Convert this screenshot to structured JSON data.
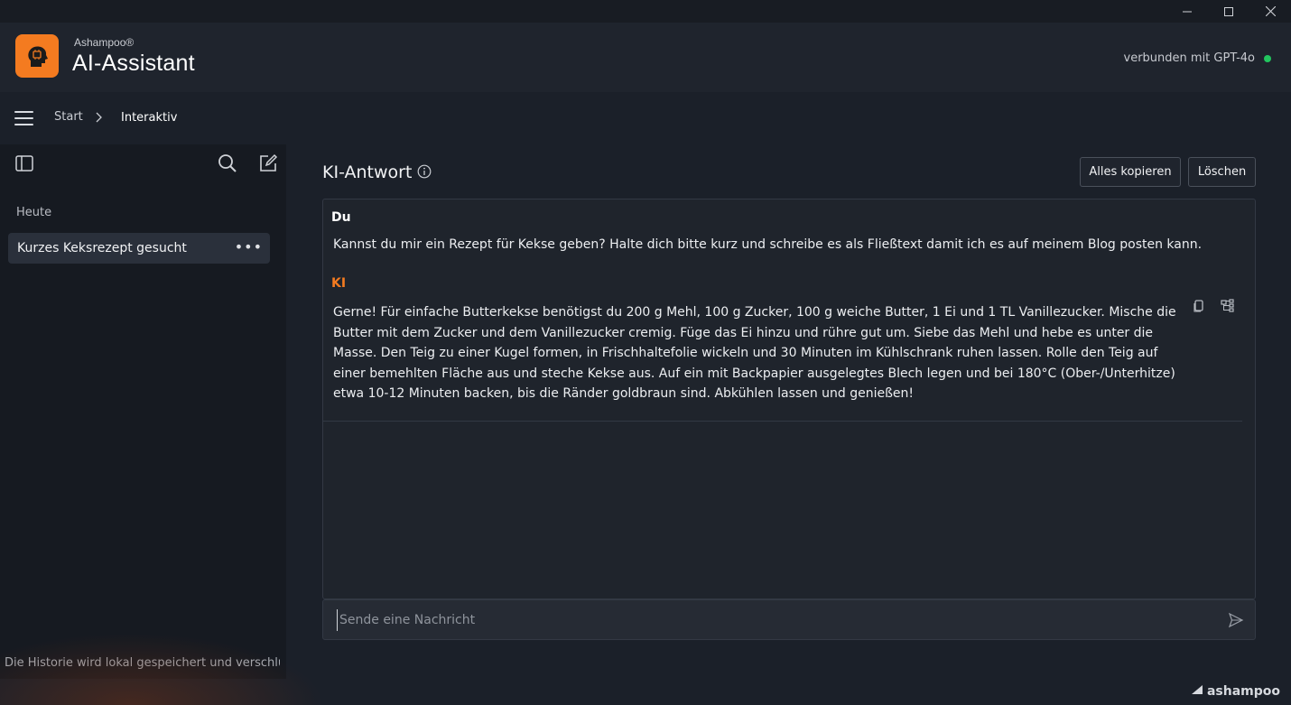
{
  "brand": {
    "small": "Ashampoo®",
    "big": "AI-Assistant",
    "footer": "ashampoo"
  },
  "status": {
    "connection": "verbunden mit GPT-4o",
    "color": "#22c55e"
  },
  "breadcrumb": {
    "start": "Start",
    "current": "Interaktiv"
  },
  "sidebar": {
    "section": "Heute",
    "items": [
      {
        "label": "Kurzes Keksrezept gesucht"
      }
    ],
    "footer": "Die Historie wird lokal gespeichert und verschlüss"
  },
  "main": {
    "title": "KI-Antwort",
    "copy_all": "Alles kopieren",
    "delete": "Löschen"
  },
  "chat": {
    "user_label": "Du",
    "user_message": "Kannst du mir ein Rezept für Kekse geben? Halte dich bitte kurz und schreibe es als Fließtext damit ich es auf meinem Blog posten kann.",
    "ai_label": "KI",
    "ai_message": "Gerne! Für einfache Butterkekse benötigst du 200 g Mehl, 100 g Zucker, 100 g weiche Butter, 1 Ei und 1 TL Vanillezucker. Mische die Butter mit dem Zucker und dem Vanillezucker cremig. Füge das Ei hinzu und rühre gut um. Siebe das Mehl und hebe es unter die Masse. Den Teig zu einer Kugel formen, in Frischhaltefolie wickeln und 30 Minuten im Kühlschrank ruhen lassen. Rolle den Teig auf einer bemehlten Fläche aus und steche Kekse aus. Auf ein mit Backpapier ausgelegtes Blech legen und bei 180°C (Ober-/Unterhitze) etwa 10-12 Minuten backen, bis die Ränder goldbraun sind. Abkühlen lassen und genießen!"
  },
  "composer": {
    "placeholder": "Sende eine Nachricht"
  },
  "colors": {
    "accent": "#f47b20",
    "background": "#1b2029"
  }
}
